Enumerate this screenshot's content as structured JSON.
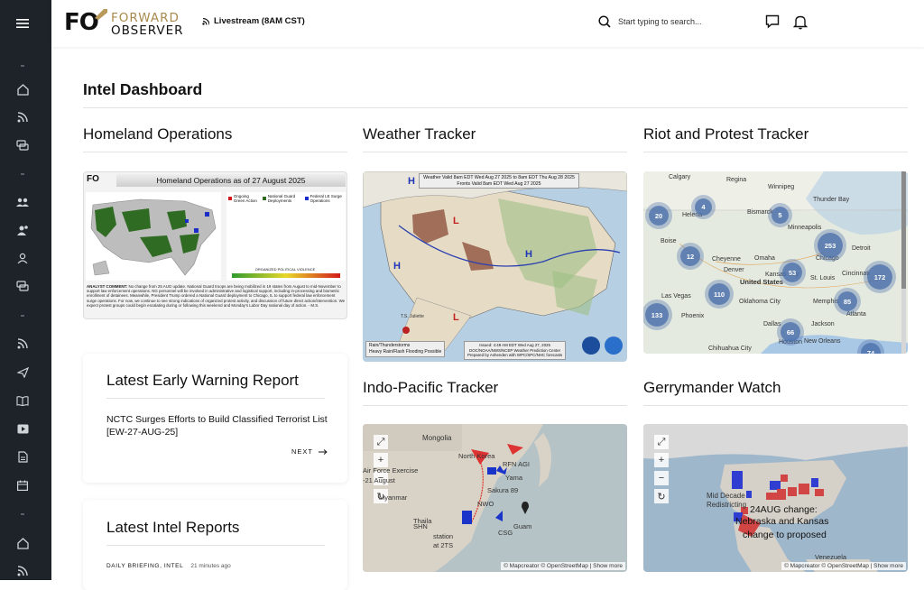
{
  "brand": {
    "mark": "FO",
    "line1": "FORWARD",
    "line2": "OBSERVER"
  },
  "header": {
    "livestream": "Livestream (8AM CST)",
    "search_placeholder": "Start typing to search..."
  },
  "sidebar": {
    "icons": [
      "menu-icon",
      "home-icon",
      "rss-icon",
      "chat-icon",
      "users-icon",
      "user-group-icon",
      "user-icon",
      "chat-bubble-icon",
      "rss-icon",
      "send-icon",
      "book-icon",
      "video-icon",
      "document-icon",
      "calendar-icon",
      "home-icon",
      "rss-icon"
    ]
  },
  "page": {
    "title": "Intel Dashboard"
  },
  "sections": {
    "homeland": {
      "title": "Homeland Operations",
      "map_title": "Homeland Operations as of 27 August 2025",
      "legend": [
        "Ongoing Green Action",
        "National Guard Deployments",
        "Federal LE Surge Operations"
      ],
      "violence_label": "ORGANIZED POLITICAL VIOLENCE",
      "comment_label": "ANALYST COMMENT:",
      "comment": "No change from 25 AUG update. National Guard troops are being mobilized in 19 states from August to mid-November to support law enforcement operations. NG personnel will be involved in administrative and logistical support, including in-processing and biometric enrollment of detainees. Meanwhile, President Trump ordered a National Guard deployment to Chicago, IL to support federal law enforcement surge operations. For now, we continue to see strong indications of organized protest activity, and discussion of future direct action/intervention. We expect protest groups could begin escalating during or following this weekend and Monday's Labor Day national day of action. - M.S."
    },
    "weather": {
      "title": "Weather Tracker",
      "map_title": "Weather Valid 8am EDT Wed Aug 27 2025 to 8am EDT Thu Aug 28 2025",
      "map_sub": "Fronts Valid 8am EDT Wed Aug 27 2025",
      "legend1": "Rain/Thunderstorms",
      "legend2": "Heavy Rain/Flash Flooding Possible",
      "issued": "Issued: 4:49 AM EDT Wed Aug 27, 2025",
      "issuer": "DOC/NOAA/NWS/NCEP Weather Prediction Center",
      "prepared": "Prepared by Ashenden with WPC/SPC/NHC forecasts",
      "storm": "T.S. Juliette"
    },
    "riot": {
      "title": "Riot and Protest Tracker",
      "places": [
        "Calgary",
        "Regina",
        "Winnipeg",
        "Thunder Bay",
        "Helena",
        "Bismarck",
        "Boise",
        "Minneapolis",
        "Cheyenne",
        "Omaha",
        "Denver",
        "Chicago",
        "United States",
        "Kansas City",
        "St. Louis",
        "Cincinnati",
        "Las Vegas",
        "Oklahoma City",
        "Memphis",
        "Phoenix",
        "Atlanta",
        "Dallas",
        "Jackson",
        "Chihuahua City",
        "Houston",
        "New Orleans",
        "Detroit"
      ],
      "clusters": [
        "20",
        "4",
        "5",
        "253",
        "12",
        "53",
        "172",
        "110",
        "85",
        "133",
        "66",
        "74"
      ]
    },
    "early": {
      "title": "Latest Early Warning Report",
      "headline": "NCTC Surges Efforts to Build Classified Terrorist List [EW-27-AUG-25]",
      "next": "NEXT"
    },
    "indo": {
      "title": "Indo-Pacific Tracker",
      "labels": [
        "Mongolia",
        "North Korea",
        "RFN AGI",
        "Air Force Exercise",
        "-21 August",
        "Yama",
        "Sakura 89",
        "NWO",
        "Myanmar",
        "Thaila",
        "SHN",
        "Guam",
        "station",
        "at 2TS",
        "CSG"
      ],
      "attrib": "© Mapcreator © OpenStreetMap | Show more"
    },
    "gerry": {
      "title": "Gerrymander Watch",
      "label1": "Mid Decade",
      "label2": "Redistricting",
      "label3": "24AUG change:",
      "label4": "Nebraska and Kansas",
      "label5": "change to proposed",
      "label6": "Venezuela",
      "attrib": "© Mapcreator © OpenStreetMap | Show more"
    },
    "reports": {
      "title": "Latest Intel Reports",
      "tags": "DAILY BRIEFING, INTEL",
      "time": "21 minutes ago"
    }
  }
}
